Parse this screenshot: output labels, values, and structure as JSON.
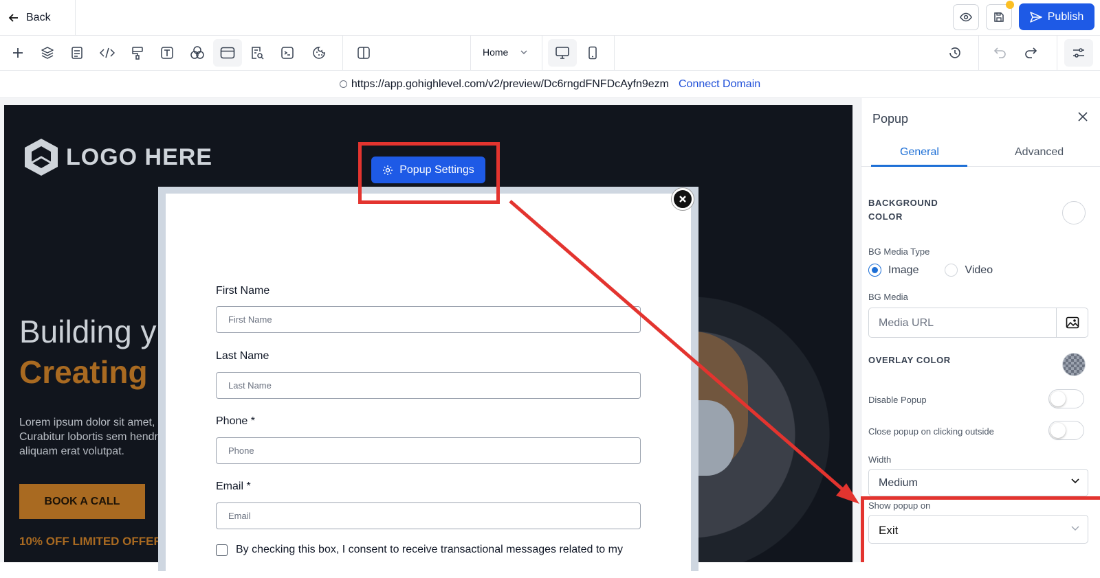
{
  "topbar": {
    "back_label": "Back",
    "publish_label": "Publish"
  },
  "toolbar": {
    "page_selector": "Home"
  },
  "urlbar": {
    "url": "https://app.gohighlevel.com/v2/preview/Dc6rngdFNFDcAyfn9ezm",
    "connect_label": "Connect Domain"
  },
  "hero": {
    "logo_text": "LOGO HERE",
    "headline_1": "Building y",
    "headline_2": "Creating r",
    "body": "Lorem ipsum dolor sit amet, c Curabitur lobortis sem hendr aliquam erat volutpat.",
    "cta": "BOOK A CALL",
    "offer": "10% OFF LIMITED OFFER"
  },
  "popup_settings_label": "Popup Settings",
  "form": {
    "fields": [
      {
        "label": "First Name",
        "placeholder": "First Name"
      },
      {
        "label": "Last Name",
        "placeholder": "Last Name"
      },
      {
        "label": "Phone *",
        "placeholder": "Phone"
      },
      {
        "label": "Email *",
        "placeholder": "Email"
      }
    ],
    "consent": "By checking this box, I consent to receive transactional messages related to my"
  },
  "panel": {
    "title": "Popup",
    "tabs": [
      "General",
      "Advanced"
    ],
    "active_tab": "General",
    "background_color_label": "BACKGROUND COLOR",
    "bg_media_type_label": "BG Media Type",
    "media_type_options": [
      "Image",
      "Video"
    ],
    "media_type_selected": "Image",
    "bg_media_label": "BG Media",
    "media_url_placeholder": "Media URL",
    "overlay_color_label": "OVERLAY COLOR",
    "disable_popup_label": "Disable Popup",
    "disable_popup": false,
    "close_outside_label": "Close popup on clicking outside",
    "close_outside": false,
    "width_label": "Width",
    "width_value": "Medium",
    "show_on_label": "Show popup on",
    "show_on_value": "Exit"
  },
  "colors": {
    "accent": "#1e5ae6",
    "highlight": "#e3342f",
    "brand_orange": "#a96a21",
    "save_dot": "#fbbf24"
  }
}
